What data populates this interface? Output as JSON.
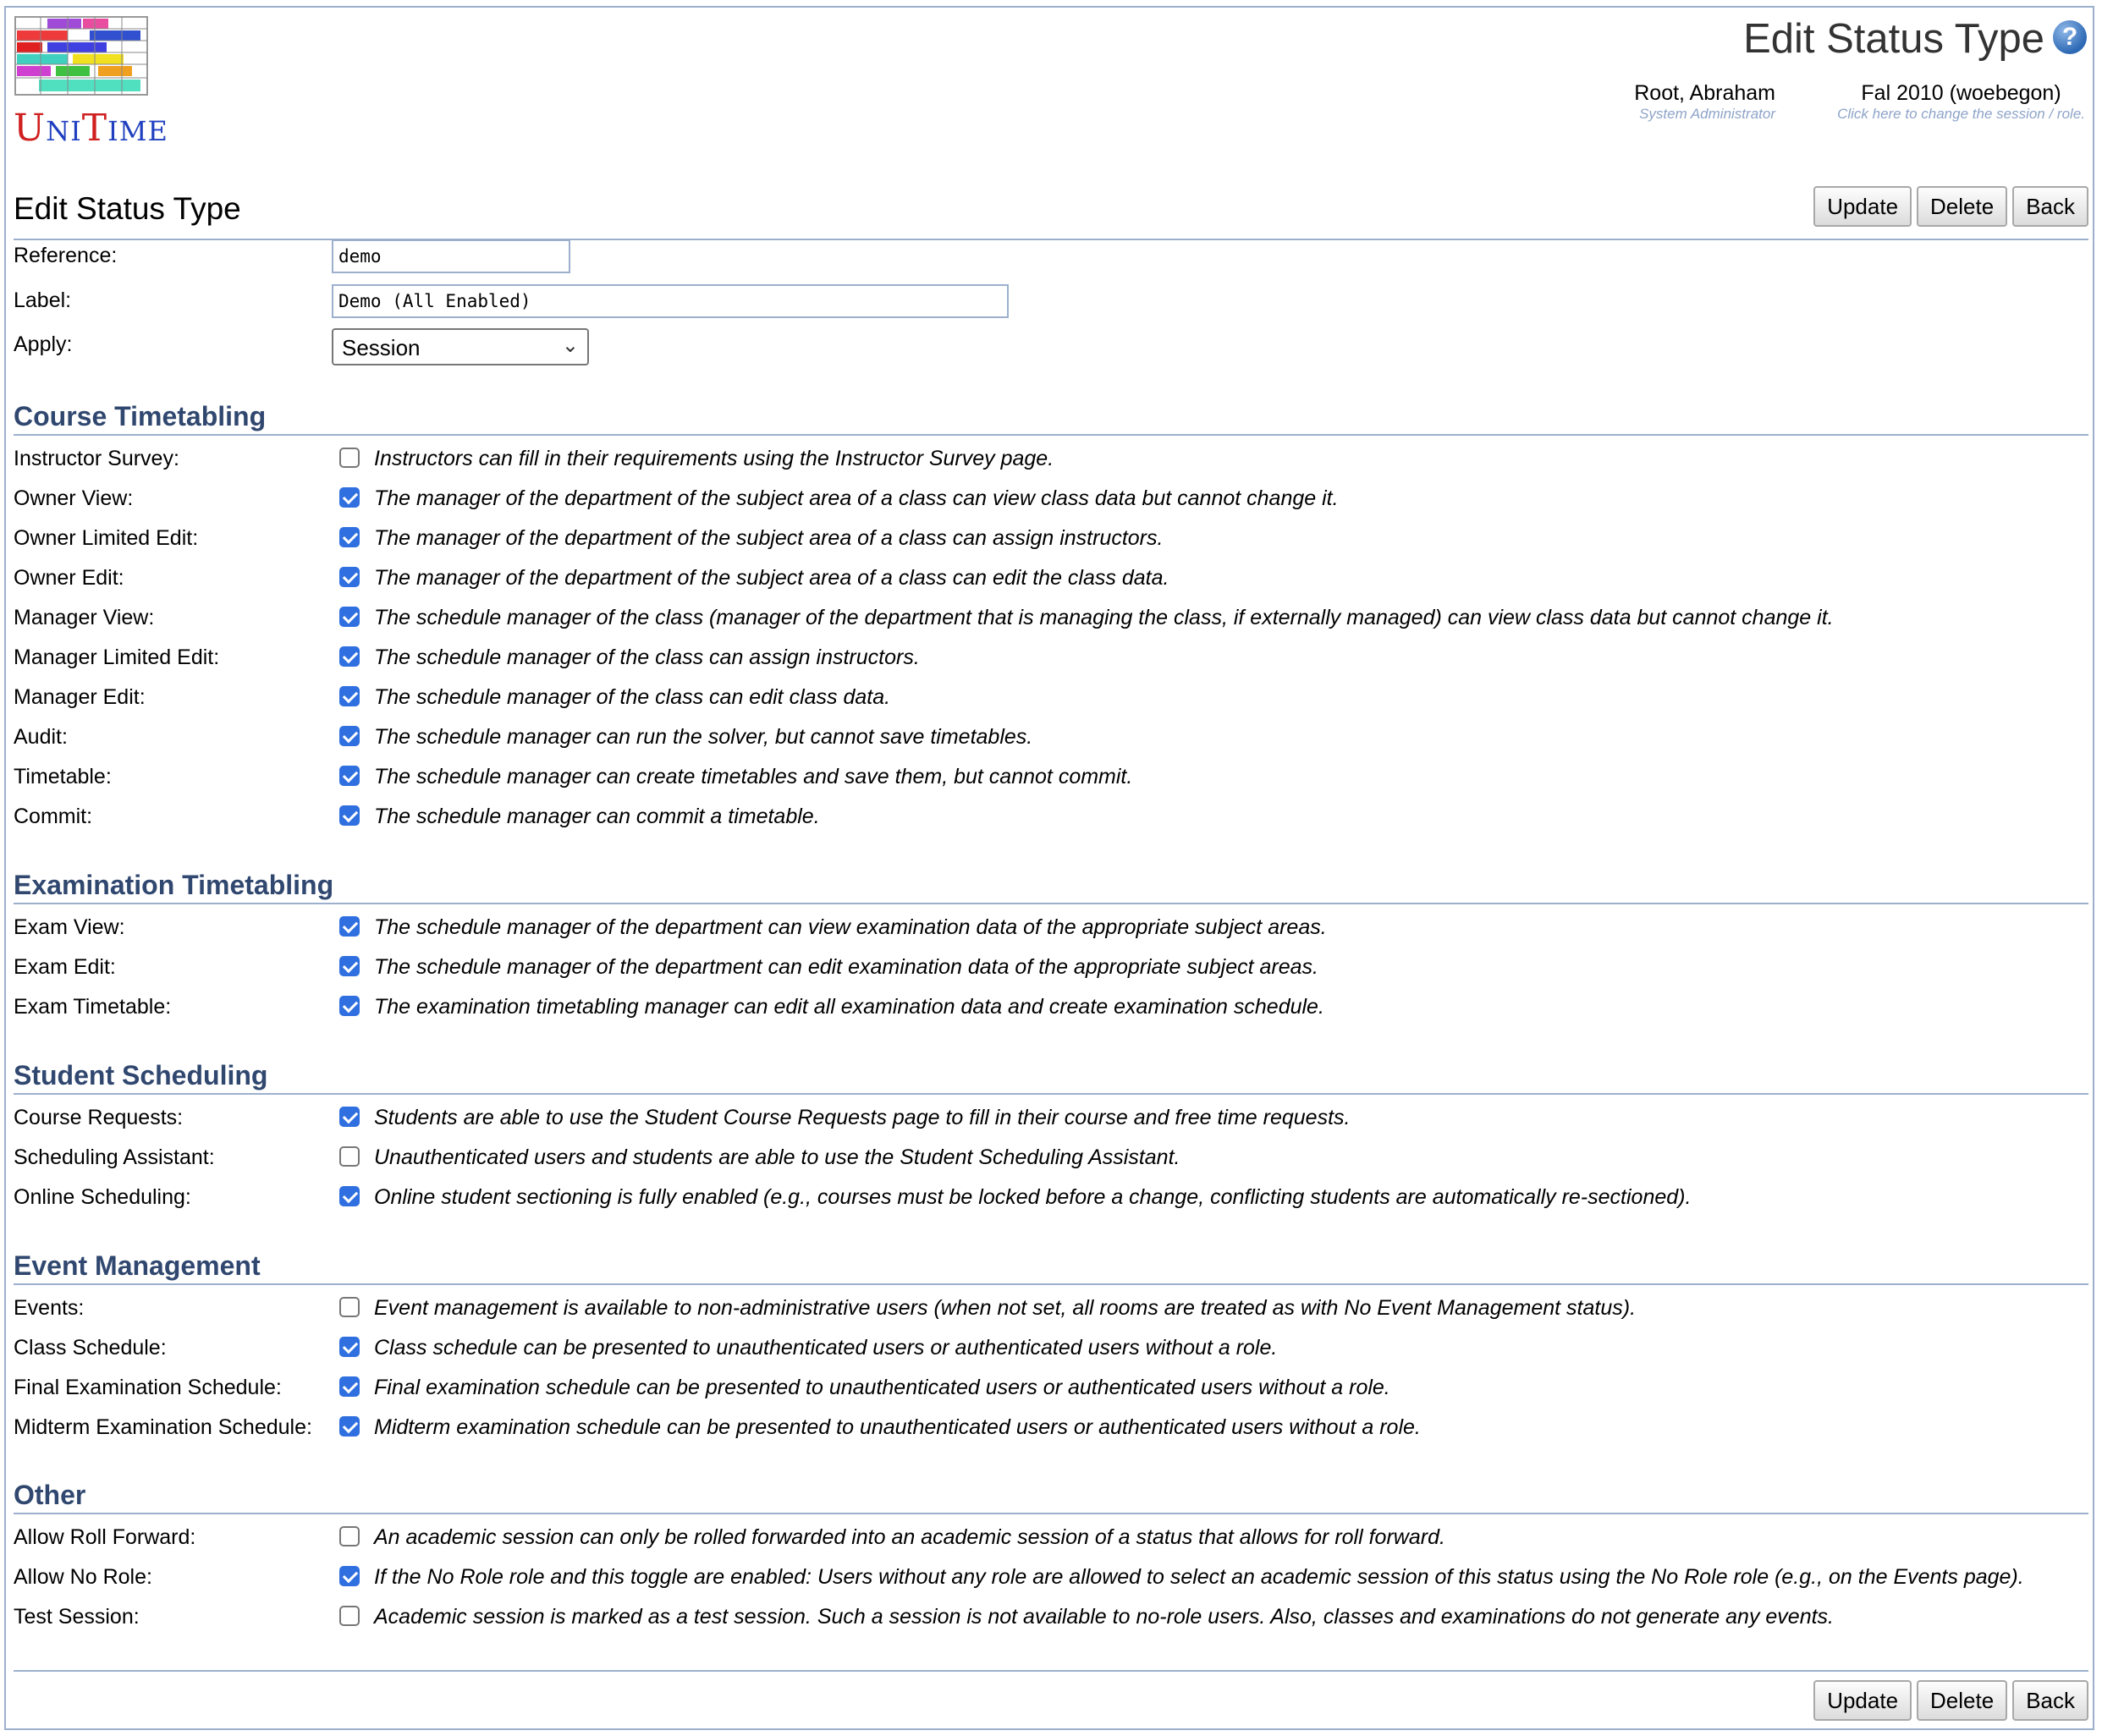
{
  "app": {
    "logo_text": "UniTime"
  },
  "page": {
    "title": "Edit Status Type"
  },
  "user": {
    "name": "Root, Abraham",
    "role": "System Administrator"
  },
  "session": {
    "name": "Fal 2010 (woebegon)",
    "hint": "Click here to change the session / role."
  },
  "form": {
    "heading": "Edit Status Type",
    "reference_label": "Reference:",
    "reference_value": "demo",
    "label_label": "Label:",
    "label_value": "Demo (All Enabled)",
    "apply_label": "Apply:",
    "apply_value": "Session"
  },
  "buttons": {
    "update": "Update",
    "delete": "Delete",
    "back": "Back"
  },
  "sections": {
    "course": {
      "title": "Course Timetabling",
      "rows": [
        {
          "label": "Instructor Survey:",
          "checked": false,
          "desc": "Instructors can fill in their requirements using the Instructor Survey page."
        },
        {
          "label": "Owner View:",
          "checked": true,
          "desc": "The manager of the department of the subject area of a class can view class data but cannot change it."
        },
        {
          "label": "Owner Limited Edit:",
          "checked": true,
          "desc": "The manager of the department of the subject area of a class can assign instructors."
        },
        {
          "label": "Owner Edit:",
          "checked": true,
          "desc": "The manager of the department of the subject area of a class can edit the class data."
        },
        {
          "label": "Manager View:",
          "checked": true,
          "desc": "The schedule manager of the class (manager of the department that is managing the class, if externally managed) can view class data but cannot change it."
        },
        {
          "label": "Manager Limited Edit:",
          "checked": true,
          "desc": "The schedule manager of the class can assign instructors."
        },
        {
          "label": "Manager Edit:",
          "checked": true,
          "desc": "The schedule manager of the class can edit class data."
        },
        {
          "label": "Audit:",
          "checked": true,
          "desc": "The schedule manager can run the solver, but cannot save timetables."
        },
        {
          "label": "Timetable:",
          "checked": true,
          "desc": "The schedule manager can create timetables and save them, but cannot commit."
        },
        {
          "label": "Commit:",
          "checked": true,
          "desc": "The schedule manager can commit a timetable."
        }
      ]
    },
    "exam": {
      "title": "Examination Timetabling",
      "rows": [
        {
          "label": "Exam View:",
          "checked": true,
          "desc": "The schedule manager of the department can view examination data of the appropriate subject areas."
        },
        {
          "label": "Exam Edit:",
          "checked": true,
          "desc": "The schedule manager of the department can edit examination data of the appropriate subject areas."
        },
        {
          "label": "Exam Timetable:",
          "checked": true,
          "desc": "The examination timetabling manager can edit all examination data and create examination schedule."
        }
      ]
    },
    "student": {
      "title": "Student Scheduling",
      "rows": [
        {
          "label": "Course Requests:",
          "checked": true,
          "desc": "Students are able to use the Student Course Requests page to fill in their course and free time requests."
        },
        {
          "label": "Scheduling Assistant:",
          "checked": false,
          "desc": "Unauthenticated users and students are able to use the Student Scheduling Assistant."
        },
        {
          "label": "Online Scheduling:",
          "checked": true,
          "desc": "Online student sectioning is fully enabled (e.g., courses must be locked before a change, conflicting students are automatically re-sectioned)."
        }
      ]
    },
    "event": {
      "title": "Event Management",
      "rows": [
        {
          "label": "Events:",
          "checked": false,
          "desc": "Event management is available to non-administrative users (when not set, all rooms are treated as with No Event Management status)."
        },
        {
          "label": "Class Schedule:",
          "checked": true,
          "desc": "Class schedule can be presented to unauthenticated users or authenticated users without a role."
        },
        {
          "label": "Final Examination Schedule:",
          "checked": true,
          "desc": "Final examination schedule can be presented to unauthenticated users or authenticated users without a role."
        },
        {
          "label": "Midterm Examination Schedule:",
          "checked": true,
          "desc": "Midterm examination schedule can be presented to unauthenticated users or authenticated users without a role."
        }
      ]
    },
    "other": {
      "title": "Other",
      "rows": [
        {
          "label": "Allow Roll Forward:",
          "checked": false,
          "desc": "An academic session can only be rolled forwarded into an academic session of a status that allows for roll forward."
        },
        {
          "label": "Allow No Role:",
          "checked": true,
          "desc": "If the No Role role and this toggle are enabled: Users without any role are allowed to select an academic session of this status using the No Role role (e.g., on the Events page)."
        },
        {
          "label": "Test Session:",
          "checked": false,
          "desc": "Academic session is marked as a test session. Such a session is not available to no-role users. Also, classes and examinations do not generate any events."
        }
      ]
    }
  }
}
